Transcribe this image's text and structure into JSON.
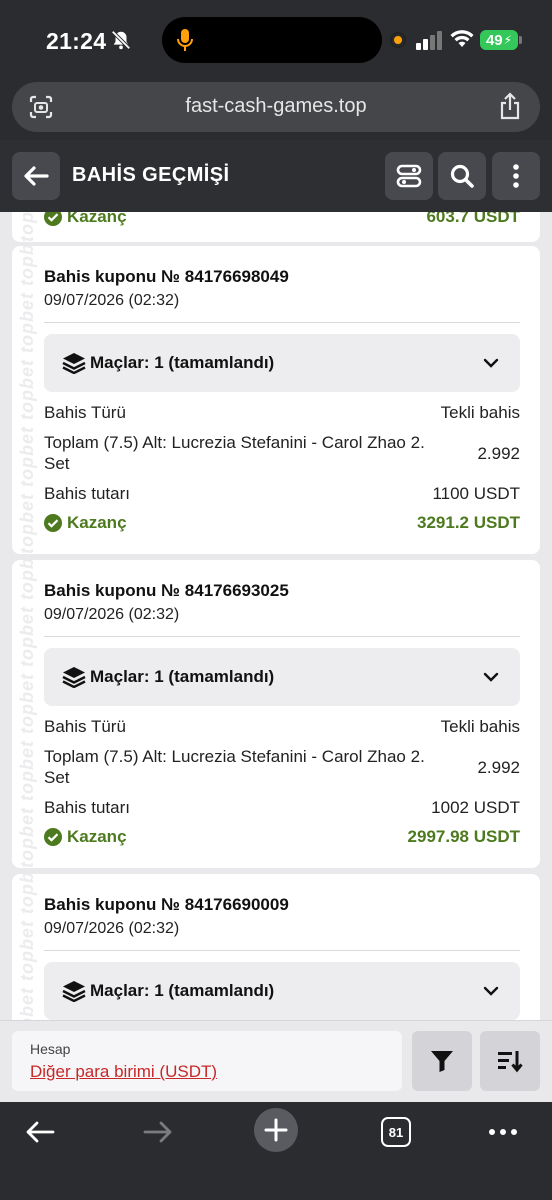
{
  "status_bar": {
    "time": "21:24",
    "battery": "49"
  },
  "browser": {
    "url": "fast-cash-games.top",
    "tab_count": "81"
  },
  "header": {
    "title": "BAHİS GEÇMİŞİ"
  },
  "watermark": "topbet topbet topbet topbet topbet topbet",
  "partial_card": {
    "win_label": "Kazanç",
    "win_value": "603.7 USDT"
  },
  "coupons": [
    {
      "title": "Bahis kuponu № 84176698049",
      "date": "09/07/2026 (02:32)",
      "matches": "Maçlar: 1 (tamamlandı)",
      "bet_type_label": "Bahis Türü",
      "bet_type_value": "Tekli bahis",
      "market": "Toplam (7.5) Alt: Lucrezia Stefanini - Carol Zhao 2. Set",
      "odds": "2.992",
      "stake_label": "Bahis tutarı",
      "stake_value": "1100 USDT",
      "win_label": "Kazanç",
      "win_value": "3291.2 USDT"
    },
    {
      "title": "Bahis kuponu № 84176693025",
      "date": "09/07/2026 (02:32)",
      "matches": "Maçlar: 1 (tamamlandı)",
      "bet_type_label": "Bahis Türü",
      "bet_type_value": "Tekli bahis",
      "market": "Toplam (7.5) Alt: Lucrezia Stefanini - Carol Zhao 2. Set",
      "odds": "2.992",
      "stake_label": "Bahis tutarı",
      "stake_value": "1002 USDT",
      "win_label": "Kazanç",
      "win_value": "2997.98 USDT"
    },
    {
      "title": "Bahis kuponu № 84176690009",
      "date": "09/07/2026 (02:32)",
      "matches": "Maçlar: 1 (tamamlandı)"
    }
  ],
  "footer": {
    "account_label": "Hesap",
    "account_value": "Diğer para birimi (USDT)"
  },
  "colors": {
    "win_green": "#4d7a1f",
    "link_red": "#c62828",
    "header_bg": "#2e2f33"
  }
}
